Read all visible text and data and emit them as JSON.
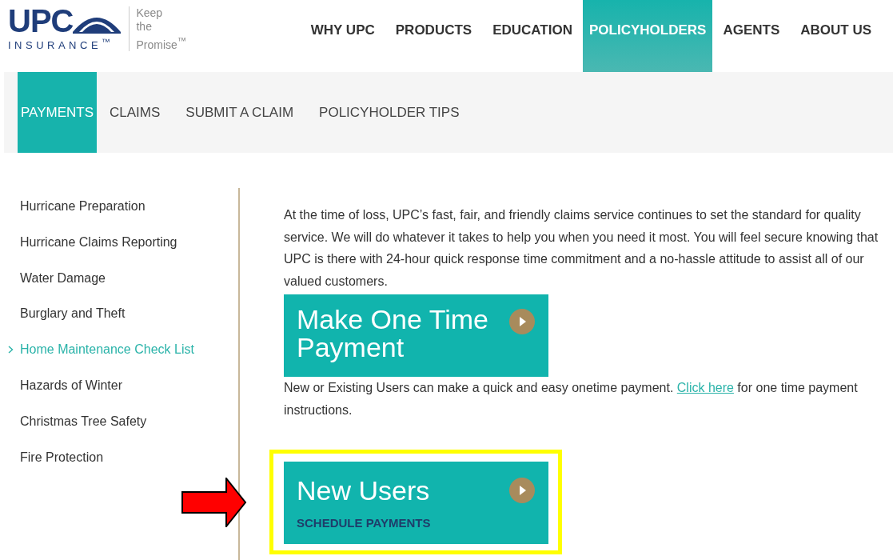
{
  "logo": {
    "wordmark": "UPC",
    "subtitle": "INSURANCE$^{™}$",
    "tagline": [
      "Keep",
      "the",
      "Promise$^{™}$"
    ]
  },
  "main_nav": [
    {
      "label": "WHY UPC",
      "selected": false
    },
    {
      "label": "PRODUCTS",
      "selected": false
    },
    {
      "label": "EDUCATION",
      "selected": false
    },
    {
      "label": "POLICYHOLDERS",
      "selected": true
    },
    {
      "label": "AGENTS",
      "selected": false
    },
    {
      "label": "ABOUT US",
      "selected": false
    }
  ],
  "sub_nav": [
    {
      "label": "PAYMENTS",
      "selected": true
    },
    {
      "label": "CLAIMS",
      "selected": false
    },
    {
      "label": "SUBMIT A CLAIM",
      "selected": false
    },
    {
      "label": "POLICYHOLDER TIPS",
      "selected": false
    }
  ],
  "sidebar": {
    "items": [
      {
        "label": "Hurricane Preparation",
        "selected": false
      },
      {
        "label": "Hurricane Claims Reporting",
        "selected": false
      },
      {
        "label": "Water Damage",
        "selected": false
      },
      {
        "label": "Burglary and Theft",
        "selected": false
      },
      {
        "label": "Home Maintenance Check List",
        "selected": true
      },
      {
        "label": "Hazards of Winter",
        "selected": false
      },
      {
        "label": "Christmas Tree Safety",
        "selected": false
      },
      {
        "label": "Fire Protection",
        "selected": false
      }
    ]
  },
  "content": {
    "intro": "At the time of loss, UPC’s fast, fair, and friendly claims service continues to set the standard for quality service. We will do whatever it takes to help you when you need it most. You will feel secure knowing that UPC is there with 24-hour quick response time commitment and a no-hassle attitude to assist all of our valued customers.",
    "one_time": {
      "title": "Make One Time Payment",
      "text_before": "New or Existing Users can make a quick and easy onetime payment.",
      "link": "Click here",
      "text_after": "for one time payment instructions."
    },
    "new_users": {
      "title": "New Users",
      "subtitle": "SCHEDULE PAYMENTS",
      "highlighted": true,
      "arrow": true
    }
  }
}
